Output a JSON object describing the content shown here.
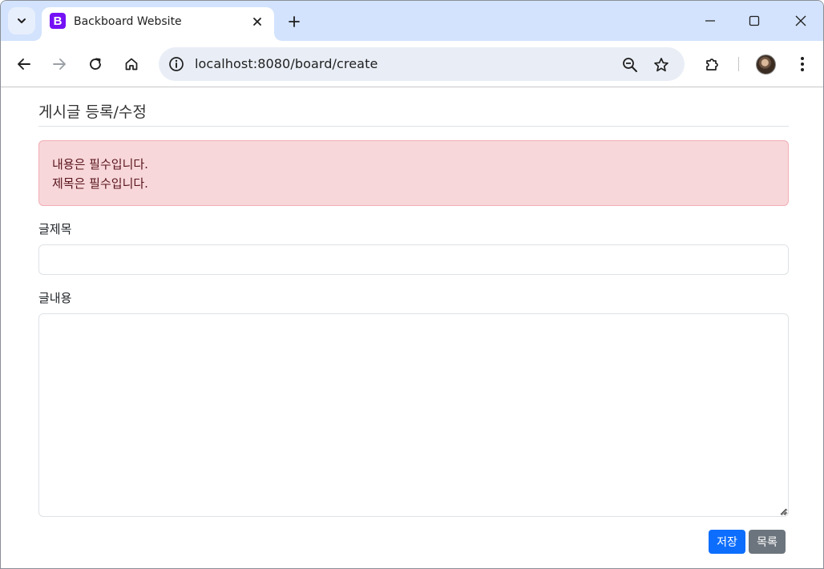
{
  "browser": {
    "tab_title": "Backboard Website",
    "favicon_letter": "B",
    "url": "localhost:8080/board/create"
  },
  "page": {
    "heading": "게시글 등록/수정",
    "errors": [
      "내용은 필수입니다.",
      "제목은 필수입니다."
    ],
    "title_label": "글제목",
    "title_value": "",
    "content_label": "글내용",
    "content_value": "",
    "save_label": "저장",
    "list_label": "목록"
  },
  "colors": {
    "tabstrip": "#d3e3fd",
    "favicon": "#7411f5",
    "alert_bg": "#f8d7da",
    "alert_text": "#58151c",
    "primary": "#0d6efd",
    "secondary": "#6c757d"
  }
}
